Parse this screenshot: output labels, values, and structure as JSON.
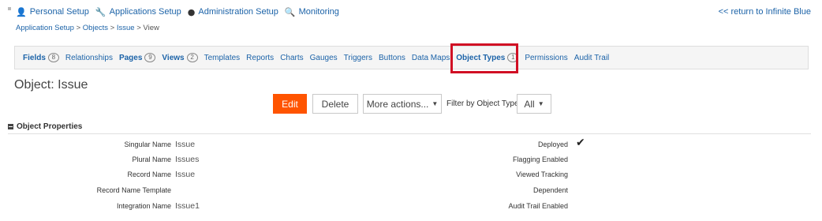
{
  "top_nav": {
    "items": [
      {
        "icon": "person-icon",
        "label": "Personal Setup"
      },
      {
        "icon": "wrench-icon",
        "label": "Applications Setup"
      },
      {
        "icon": "globe-icon",
        "label": "Administration Setup"
      },
      {
        "icon": "search-icon",
        "label": "Monitoring"
      }
    ],
    "return_link": "<< return to Infinite Blue"
  },
  "breadcrumb": {
    "items": [
      "Application Setup",
      "Objects",
      "Issue",
      "View"
    ],
    "separator": ">"
  },
  "tabs": [
    {
      "label": "Fields",
      "count": "8",
      "bold": true
    },
    {
      "label": "Relationships",
      "count": null,
      "bold": false
    },
    {
      "label": "Pages",
      "count": "9",
      "bold": true
    },
    {
      "label": "Views",
      "count": "2",
      "bold": true
    },
    {
      "label": "Templates",
      "count": null,
      "bold": false
    },
    {
      "label": "Reports",
      "count": null,
      "bold": false
    },
    {
      "label": "Charts",
      "count": null,
      "bold": false
    },
    {
      "label": "Gauges",
      "count": null,
      "bold": false
    },
    {
      "label": "Triggers",
      "count": null,
      "bold": false
    },
    {
      "label": "Buttons",
      "count": null,
      "bold": false
    },
    {
      "label": "Data Maps",
      "count": null,
      "bold": false
    },
    {
      "label": "Object Types",
      "count": "1",
      "bold": true,
      "highlighted": true
    },
    {
      "label": "Permissions",
      "count": null,
      "bold": false
    },
    {
      "label": "Audit Trail",
      "count": null,
      "bold": false
    }
  ],
  "highlight_color": "#d10f24",
  "object_title": "Object: Issue",
  "actions": {
    "edit": "Edit",
    "delete": "Delete",
    "more": "More actions...",
    "filter_label": "Filter by Object Type",
    "filter_value": "All"
  },
  "accent_color": "#ff5400",
  "section": {
    "title": "Object Properties",
    "left": [
      {
        "label": "Singular Name",
        "value": "Issue"
      },
      {
        "label": "Plural Name",
        "value": "Issues"
      },
      {
        "label": "Record Name",
        "value": "Issue"
      },
      {
        "label": "Record Name Template",
        "value": ""
      },
      {
        "label": "Integration Name",
        "value": "Issue1"
      }
    ],
    "right": [
      {
        "label": "Deployed",
        "checked": true
      },
      {
        "label": "Flagging Enabled",
        "checked": false
      },
      {
        "label": "Viewed Tracking",
        "checked": false
      },
      {
        "label": "Dependent",
        "checked": false
      },
      {
        "label": "Audit Trail Enabled",
        "checked": false
      }
    ]
  }
}
